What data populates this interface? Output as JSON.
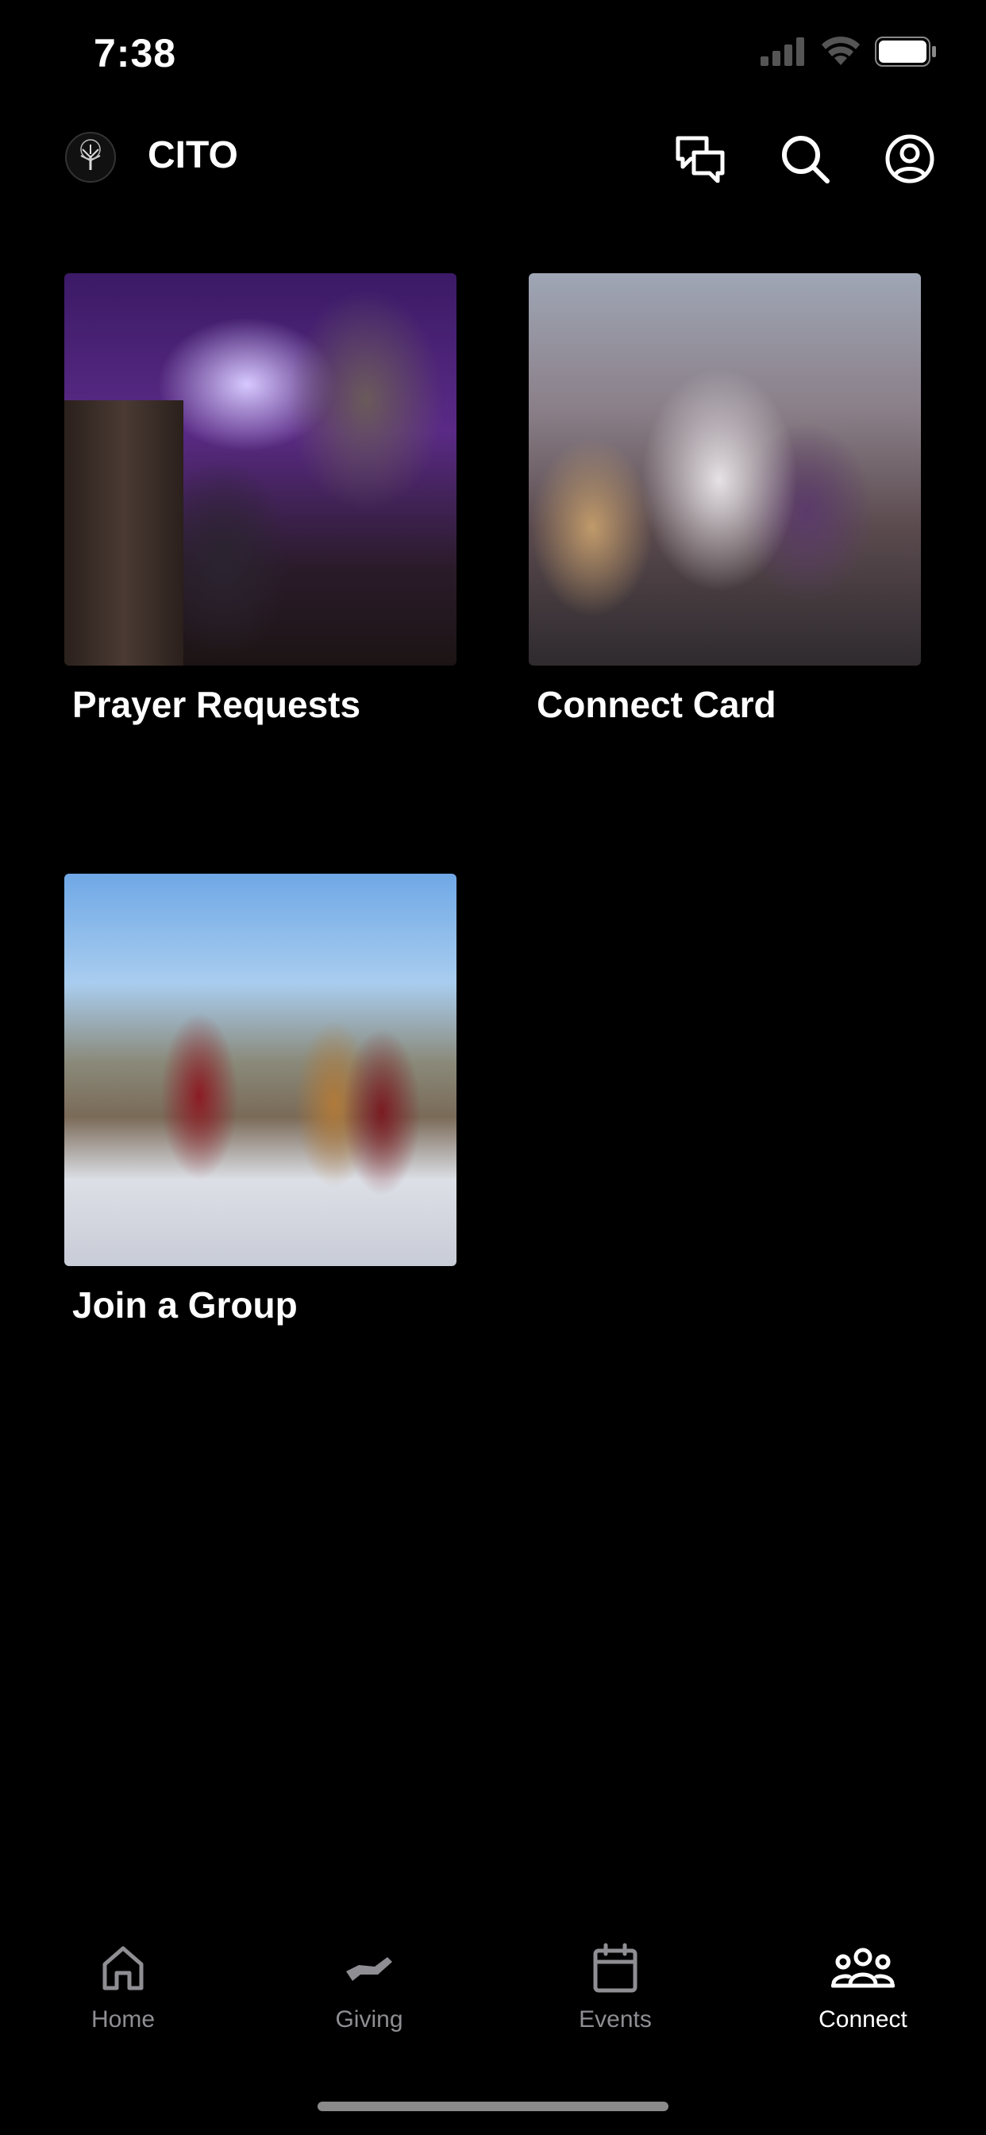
{
  "status_bar": {
    "time": "7:38"
  },
  "header": {
    "title": "CITO",
    "logo_icon": "tree-logo-icon",
    "actions": [
      "chat-icon",
      "search-icon",
      "profile-icon"
    ]
  },
  "cards": [
    {
      "label": "Prayer Requests",
      "image": "people praying at altar"
    },
    {
      "label": "Connect Card",
      "image": "people hugging in sanctuary"
    },
    {
      "label": "Join a Group",
      "image": "men talking outdoors"
    }
  ],
  "tabs": [
    {
      "label": "Home",
      "icon": "home-icon",
      "active": false
    },
    {
      "label": "Giving",
      "icon": "giving-icon",
      "active": false
    },
    {
      "label": "Events",
      "icon": "calendar-icon",
      "active": false
    },
    {
      "label": "Connect",
      "icon": "people-icon",
      "active": true
    }
  ],
  "colors": {
    "background": "#000000",
    "text": "#ffffff",
    "inactive": "#8e8e93"
  }
}
